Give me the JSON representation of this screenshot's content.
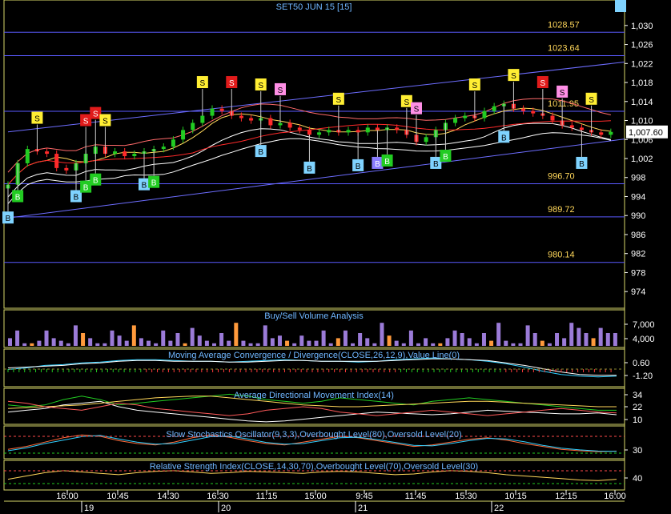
{
  "colors": {
    "background": "#000000",
    "title_text": "#6fb6ff",
    "level_text": "#ffd75a",
    "axis_text": "#ffffff",
    "hline": "#5a5aff",
    "up_candle": "#22cc22",
    "down_candle": "#ff2a2a",
    "sell_tag": "#ffee33",
    "sell_strong": "#e01b1b",
    "buy_tag": "#7fd3ff",
    "buy_strong": "#22cc22",
    "pink_tag": "#ff8fe6",
    "volume_bar": "#9b7bd8",
    "last_price_box": "#ffffff"
  },
  "chart_data": [
    {
      "type": "line",
      "title": "SET50 JUN 15   [15]",
      "ylim": [
        971,
        1033
      ],
      "y_ticks": [
        "1,030",
        "1,026",
        "1,022",
        "1,018",
        "1,014",
        "1,010",
        "1,006",
        "1,002",
        "998",
        "994",
        "990",
        "986",
        "982",
        "978",
        "974"
      ],
      "y_tick_values": [
        1030,
        1026,
        1022,
        1018,
        1014,
        1010,
        1006,
        1002,
        998,
        994,
        990,
        986,
        982,
        978,
        974
      ],
      "levels": [
        {
          "label": "1028.57",
          "value": 1028.57
        },
        {
          "label": "1023.64",
          "value": 1023.64
        },
        {
          "label": "1011.95",
          "value": 1011.95
        },
        {
          "label": "996.70",
          "value": 996.7
        },
        {
          "label": "989.72",
          "value": 989.72
        },
        {
          "label": "980.14",
          "value": 980.14
        }
      ],
      "last_price_label": "1,007.60",
      "last_price": 1007.6,
      "close": [
        996.5,
        1001,
        1004,
        1003.5,
        1003,
        1000,
        999.5,
        1001,
        1003,
        1004.5,
        1003,
        1003.5,
        1002.5,
        1003,
        1003.5,
        1004,
        1004.5,
        1006,
        1008,
        1009.5,
        1011,
        1012.5,
        1012,
        1011,
        1010.5,
        1010,
        1010.5,
        1009,
        1009.5,
        1008.5,
        1008,
        1007,
        1007.5,
        1008,
        1007.5,
        1008,
        1007.5,
        1008.5,
        1008,
        1008.5,
        1008,
        1007,
        1005.5,
        1006.5,
        1008,
        1009.5,
        1010.5,
        1011,
        1010.5,
        1012,
        1013,
        1013.5,
        1012.5,
        1012,
        1011.5,
        1011,
        1010,
        1009,
        1008.5,
        1008,
        1007.5,
        1007,
        1007.6
      ],
      "channel": [
        {
          "name": "upper trendline",
          "x": [
            0,
            62
          ],
          "y": [
            1007.6,
            1022.3
          ]
        },
        {
          "name": "lower trendline",
          "x": [
            0,
            62
          ],
          "y": [
            989.5,
            1006.1
          ]
        }
      ],
      "markers": [
        {
          "i": 3,
          "tag": "S",
          "kind": "sell"
        },
        {
          "i": 8,
          "tag": "S",
          "kind": "sell_strong"
        },
        {
          "i": 9,
          "tag": "S",
          "kind": "sell_strong"
        },
        {
          "i": 10,
          "tag": "S",
          "kind": "sell"
        },
        {
          "i": 20,
          "tag": "S",
          "kind": "sell"
        },
        {
          "i": 23,
          "tag": "S",
          "kind": "sell_strong"
        },
        {
          "i": 26,
          "tag": "S",
          "kind": "sell"
        },
        {
          "i": 28,
          "tag": "S",
          "kind": "pink"
        },
        {
          "i": 34,
          "tag": "S",
          "kind": "sell"
        },
        {
          "i": 41,
          "tag": "S",
          "kind": "sell"
        },
        {
          "i": 42,
          "tag": "S",
          "kind": "pink"
        },
        {
          "i": 48,
          "tag": "S",
          "kind": "sell"
        },
        {
          "i": 52,
          "tag": "S",
          "kind": "sell"
        },
        {
          "i": 55,
          "tag": "S",
          "kind": "sell_strong"
        },
        {
          "i": 57,
          "tag": "S",
          "kind": "pink"
        },
        {
          "i": 60,
          "tag": "S",
          "kind": "sell"
        },
        {
          "i": 0,
          "tag": "B",
          "kind": "buy"
        },
        {
          "i": 1,
          "tag": "B",
          "kind": "buy_strong"
        },
        {
          "i": 7,
          "tag": "B",
          "kind": "buy"
        },
        {
          "i": 8,
          "tag": "B",
          "kind": "buy_strong"
        },
        {
          "i": 9,
          "tag": "B",
          "kind": "buy_strong"
        },
        {
          "i": 14,
          "tag": "B",
          "kind": "buy"
        },
        {
          "i": 15,
          "tag": "B",
          "kind": "buy_strong"
        },
        {
          "i": 26,
          "tag": "B",
          "kind": "buy"
        },
        {
          "i": 31,
          "tag": "B",
          "kind": "buy"
        },
        {
          "i": 36,
          "tag": "B",
          "kind": "buy"
        },
        {
          "i": 38,
          "tag": "B",
          "kind": "purple"
        },
        {
          "i": 39,
          "tag": "B",
          "kind": "buy_strong"
        },
        {
          "i": 44,
          "tag": "B",
          "kind": "buy"
        },
        {
          "i": 45,
          "tag": "B",
          "kind": "buy_strong"
        },
        {
          "i": 51,
          "tag": "B",
          "kind": "buy"
        },
        {
          "i": 59,
          "tag": "B",
          "kind": "buy"
        },
        {
          "i": 63,
          "tag": "B",
          "kind": "buy"
        }
      ]
    },
    {
      "type": "bar",
      "title": "Buy/Sell Volume Analysis",
      "y_ticks": [
        "7,000",
        "4,000"
      ],
      "values": [
        3,
        6,
        1,
        1,
        2,
        6,
        3,
        2,
        1,
        8,
        5,
        3,
        1,
        1,
        6,
        4,
        2,
        8,
        3,
        2,
        1,
        6,
        2,
        5,
        1,
        7,
        4,
        2,
        1,
        5,
        2,
        9,
        2,
        1,
        1,
        8,
        3,
        4,
        2,
        1,
        4,
        2,
        2,
        6,
        1,
        3,
        6,
        1,
        5,
        3,
        1,
        9,
        4,
        2,
        1,
        6,
        1,
        3,
        1,
        1,
        3,
        6,
        5,
        3,
        1,
        5,
        2,
        9,
        2,
        1,
        1,
        8,
        5,
        2,
        1,
        5,
        3,
        9,
        7,
        5,
        3,
        7,
        5,
        5
      ],
      "ylim": [
        0,
        10
      ]
    },
    {
      "type": "line",
      "title": "Moving Average Convergence / Divergence(CLOSE,26,12,9),Value Line(0)",
      "y_ticks": [
        "0.60",
        "-1.20"
      ],
      "ylim": [
        -2,
        1.5
      ],
      "series": [
        {
          "values": [
            -0.4,
            -0.2,
            0.1,
            0.2,
            0.4,
            0.5,
            0.7,
            0.8,
            0.8,
            0.7,
            0.6,
            0.6,
            0.5,
            0.6,
            0.7,
            0.8,
            0.7,
            0.6,
            0.6,
            0.5,
            0.6,
            0.8,
            0.9,
            1.0,
            0.9,
            0.8,
            0.6,
            0.3,
            -0.1,
            -0.6,
            -1.0,
            -1.2,
            -1.3,
            -1.2
          ]
        },
        {
          "values": [
            -0.2,
            -0.1,
            0.0,
            0.1,
            0.3,
            0.4,
            0.6,
            0.7,
            0.7,
            0.6,
            0.6,
            0.6,
            0.5,
            0.5,
            0.6,
            0.7,
            0.7,
            0.6,
            0.6,
            0.6,
            0.6,
            0.7,
            0.8,
            0.9,
            0.9,
            0.8,
            0.7,
            0.4,
            0.1,
            -0.3,
            -0.7,
            -1.0,
            -1.1,
            -1.1
          ]
        }
      ]
    },
    {
      "type": "line",
      "title": "Average Directional Movement Index(14)",
      "y_ticks": [
        "34",
        "22",
        "10"
      ],
      "ylim": [
        4,
        40
      ],
      "series": [
        {
          "values": [
            16,
            18,
            20,
            24,
            26,
            28,
            22,
            18,
            16,
            14,
            12,
            10,
            8,
            6,
            5,
            6,
            8,
            10,
            12,
            14,
            16,
            15,
            14,
            13,
            14,
            16,
            18,
            17,
            16,
            15,
            14,
            14,
            15,
            13
          ]
        },
        {
          "values": [
            24,
            22,
            24,
            30,
            34,
            30,
            24,
            26,
            28,
            30,
            32,
            34,
            36,
            34,
            30,
            28,
            26,
            28,
            32,
            30,
            28,
            26,
            24,
            28,
            30,
            32,
            30,
            28,
            26,
            24,
            22,
            20,
            18,
            18
          ]
        },
        {
          "values": [
            20,
            21,
            22,
            23,
            24,
            26,
            28,
            30,
            32,
            33,
            34,
            34,
            32,
            30,
            28,
            26,
            24,
            23,
            22,
            22,
            23,
            24,
            25,
            26,
            27,
            28,
            28,
            27,
            26,
            25,
            24,
            23,
            22,
            22
          ]
        },
        {
          "values": [
            28,
            26,
            22,
            20,
            18,
            22,
            26,
            24,
            20,
            18,
            16,
            14,
            12,
            14,
            18,
            20,
            22,
            20,
            16,
            14,
            12,
            14,
            16,
            18,
            16,
            14,
            12,
            14,
            16,
            18,
            20,
            18,
            16,
            15
          ]
        }
      ]
    },
    {
      "type": "line",
      "title": "Slow Stochastics Oscillator(9,3,3),Overbought Level(80),Oversold Level(20)",
      "y_ticks": [
        "30"
      ],
      "ylim": [
        0,
        100
      ],
      "series": [
        {
          "values": [
            30,
            40,
            55,
            70,
            80,
            75,
            60,
            50,
            45,
            55,
            70,
            80,
            72,
            60,
            50,
            45,
            55,
            65,
            75,
            70,
            60,
            50,
            40,
            45,
            55,
            65,
            70,
            62,
            50,
            40,
            30,
            25,
            22,
            24
          ]
        },
        {
          "values": [
            25,
            35,
            50,
            62,
            74,
            78,
            66,
            55,
            48,
            50,
            62,
            74,
            76,
            66,
            54,
            48,
            50,
            60,
            70,
            72,
            64,
            54,
            44,
            42,
            50,
            60,
            68,
            66,
            56,
            44,
            34,
            28,
            24,
            23
          ]
        }
      ]
    },
    {
      "type": "line",
      "title": "Relative Strength Index(CLOSE,14,30,70),Overbought Level(70),Oversold Level(30)",
      "y_ticks": [
        "40"
      ],
      "ylim": [
        30,
        70
      ],
      "series": [
        {
          "values": [
            45,
            50,
            55,
            58,
            56,
            54,
            52,
            55,
            57,
            58,
            56,
            54,
            55,
            57,
            56,
            55,
            54,
            56,
            57,
            56,
            54,
            52,
            53,
            56,
            58,
            57,
            55,
            52,
            50,
            48,
            46,
            44,
            43,
            45
          ]
        }
      ]
    }
  ],
  "x_axis": {
    "time_labels": [
      "16:00",
      "10:45",
      "14:30",
      "16:30",
      "11:15",
      "15:00",
      "9:45",
      "11:45",
      "15:30",
      "10:15",
      "12:15",
      "16:00"
    ],
    "day_labels": [
      "19",
      "20",
      "21",
      "22"
    ]
  }
}
